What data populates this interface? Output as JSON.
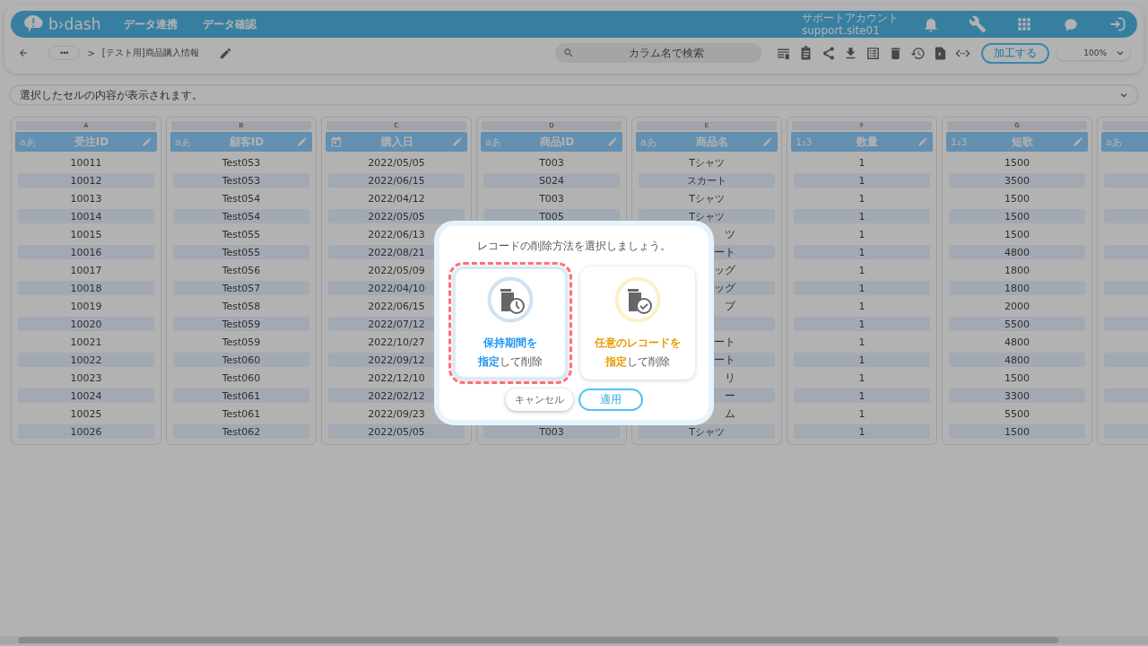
{
  "header": {
    "logo": "b›dash",
    "nav": [
      {
        "label": "データ連携"
      },
      {
        "label": "データ確認"
      }
    ],
    "account": {
      "name": "サポートアカウント",
      "id": "support.site01"
    }
  },
  "toolbar": {
    "more": "•••",
    "separator": ">",
    "title": "[テスト用]商品購入情報",
    "search": {
      "placeholder": "カラム名で検索"
    },
    "process_button": "加工する",
    "zoom": "100%"
  },
  "cell_viewer": {
    "placeholder": "選択したセルの内容が表示されます。"
  },
  "columns": [
    {
      "letter": "A",
      "name": "受注ID",
      "kind": "text",
      "type_label": "aあ",
      "cells": [
        "10011",
        "10012",
        "10013",
        "10014",
        "10015",
        "10016",
        "10017",
        "10018",
        "10019",
        "10020",
        "10021",
        "10022",
        "10023",
        "10024",
        "10025",
        "10026"
      ]
    },
    {
      "letter": "B",
      "name": "顧客ID",
      "kind": "text",
      "type_label": "aあ",
      "cells": [
        "Test053",
        "Test053",
        "Test054",
        "Test054",
        "Test055",
        "Test055",
        "Test056",
        "Test057",
        "Test058",
        "Test059",
        "Test059",
        "Test060",
        "Test060",
        "Test061",
        "Test061",
        "Test062"
      ]
    },
    {
      "letter": "C",
      "name": "購入日",
      "kind": "date",
      "cells": [
        "2022/05/05",
        "2022/06/15",
        "2022/04/12",
        "2022/05/05",
        "2022/06/13",
        "2022/08/21",
        "2022/05/09",
        "2022/04/10",
        "2022/06/15",
        "2022/07/12",
        "2022/10/27",
        "2022/09/12",
        "2022/12/10",
        "2022/02/12",
        "2022/09/23",
        "2022/05/05"
      ]
    },
    {
      "letter": "D",
      "name": "商品ID",
      "kind": "text",
      "type_label": "aあ",
      "cells": [
        "T003",
        "S024",
        "T003",
        "T005"
      ],
      "bottom_cells": [
        "T003"
      ]
    },
    {
      "letter": "E",
      "name": "商品名",
      "kind": "text",
      "type_label": "aあ",
      "cells": [
        "Tシャツ",
        "スカート",
        "Tシャツ",
        "Tシャツ",
        {
          "text": "ツ",
          "partial": true
        },
        {
          "text": "ート",
          "partial": true
        },
        {
          "text": "ッグ",
          "partial": true
        },
        {
          "text": "ッグ",
          "partial": true
        },
        {
          "text": "プ",
          "partial": true
        },
        null,
        {
          "text": "ート",
          "partial": true
        },
        {
          "text": "ート",
          "partial": true
        },
        {
          "text": "リ",
          "partial": true
        },
        {
          "text": "ー",
          "partial": true
        },
        {
          "text": "ム",
          "partial": true
        },
        "Tシャツ"
      ]
    },
    {
      "letter": "F",
      "name": "数量",
      "kind": "number",
      "type_label": "1₂3",
      "cells": [
        "1",
        "1",
        "1",
        "1",
        "1",
        "1",
        "1",
        "1",
        "1",
        "1",
        "1",
        "1",
        "1",
        "1",
        "1",
        "1"
      ]
    },
    {
      "letter": "G",
      "name": "短歌",
      "kind": "number",
      "type_label": "1₂3",
      "cells": [
        "1500",
        "3500",
        "1500",
        "1500",
        "1500",
        "4800",
        "1800",
        "1800",
        "2000",
        "5500",
        "4800",
        "4800",
        "1500",
        "3300",
        "5500",
        "1500"
      ]
    },
    {
      "kind": "text",
      "type_label": "aあ",
      "cells": [
        null,
        null,
        null,
        null,
        null,
        null,
        null,
        null,
        null,
        null,
        null,
        null,
        null,
        null,
        null,
        null
      ]
    }
  ],
  "dialog": {
    "prompt": "レコードの削除方法を選択しましょう。",
    "options": [
      {
        "kind": "retention",
        "line1": "保持期間を",
        "accent": "指定",
        "rest": "して削除",
        "color": "#2196f3",
        "selected": true
      },
      {
        "kind": "manual",
        "line1": "任意のレコードを",
        "accent": "指定",
        "rest": "して削除",
        "color": "#e89a00",
        "selected": false
      }
    ],
    "cancel": "キャンセル",
    "apply": "適用"
  }
}
